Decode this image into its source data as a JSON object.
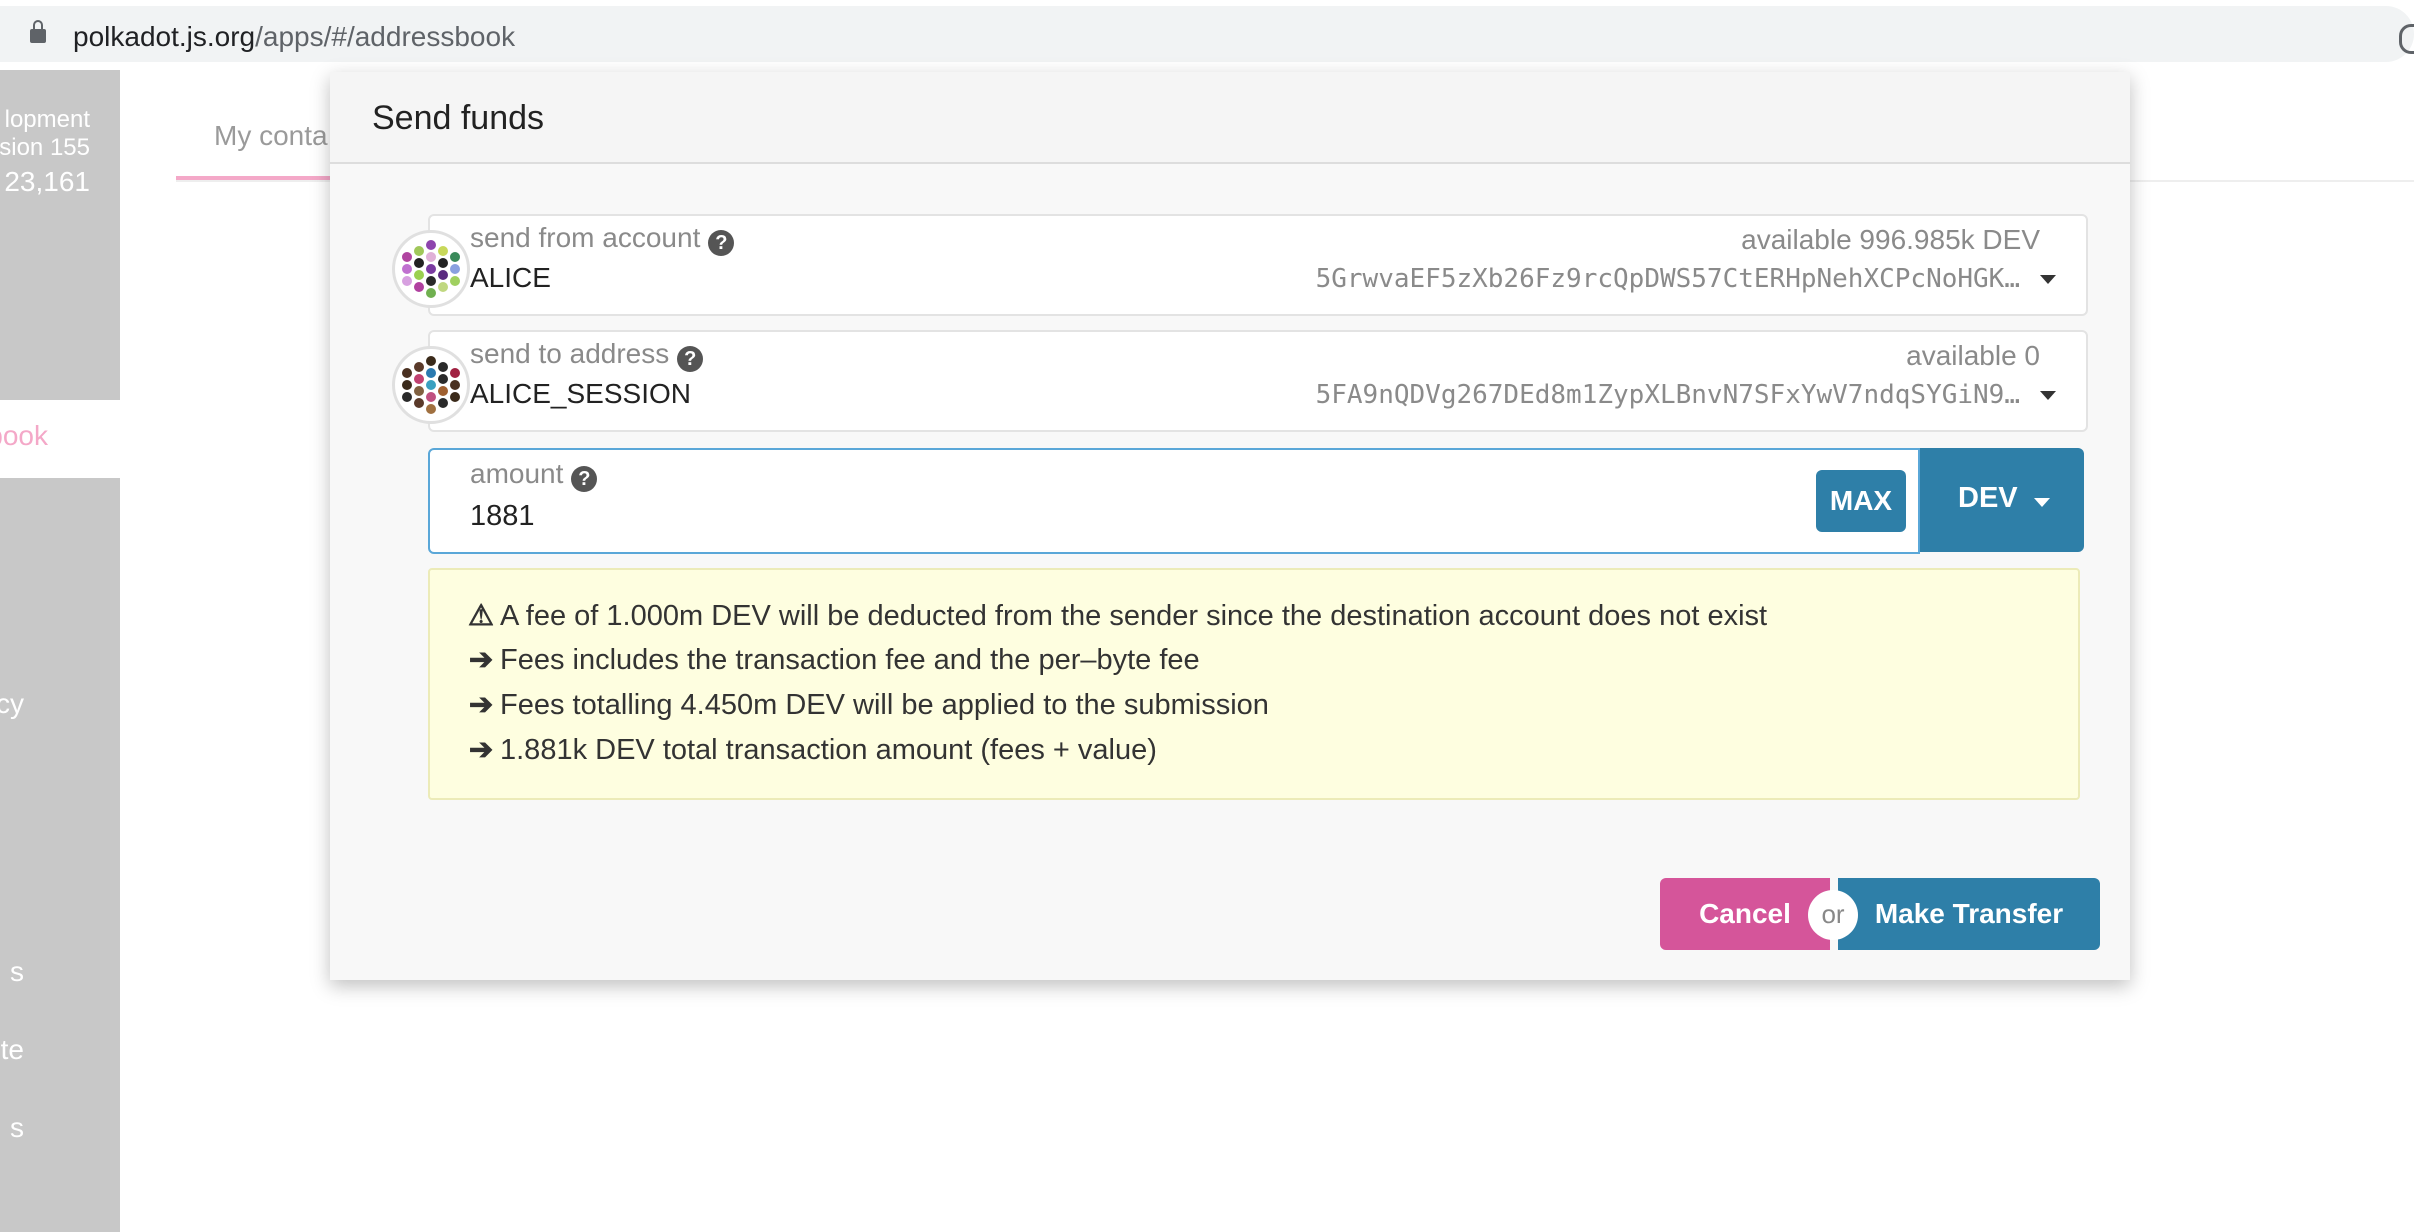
{
  "browser": {
    "url_domain": "polkadot.js.org",
    "url_path": "/apps/#/addressbook"
  },
  "background_app": {
    "chain_label": "lopment",
    "version_label": "sion 155",
    "block_label": "23,161",
    "sidebar_active": "book",
    "sidebar_items": [
      "cy",
      "s",
      "te",
      "s"
    ],
    "tab_contacts": "My conta"
  },
  "modal": {
    "title": "Send funds",
    "from": {
      "label": "send from account",
      "name": "ALICE",
      "available": "available 996.985k DEV",
      "address": "5GrwvaEF5zXb26Fz9rcQpDWS57CtERHpNehXCPcNoHGK…"
    },
    "to": {
      "label": "send to address",
      "name": "ALICE_SESSION",
      "available": "available 0",
      "address": "5FA9nQDVg267DEd8m1ZypXLBnvN7SFxYwV7ndqSYGiN9…"
    },
    "amount": {
      "label": "amount",
      "value": "1881",
      "max_label": "MAX",
      "unit": "DEV"
    },
    "notices": [
      {
        "icon": "warning-icon",
        "glyph": "⚠",
        "text": "A fee of 1.000m DEV will be deducted from the sender since the destination account does not exist"
      },
      {
        "icon": "arrow-right-icon",
        "glyph": "➔",
        "text": "Fees includes the transaction fee and the per–byte fee"
      },
      {
        "icon": "arrow-right-icon",
        "glyph": "➔",
        "text": "Fees totalling 4.450m DEV will be applied to the submission"
      },
      {
        "icon": "arrow-right-icon",
        "glyph": "➔",
        "text": "1.881k DEV total transaction amount (fees + value)"
      }
    ],
    "cancel_label": "Cancel",
    "or_label": "or",
    "transfer_label": "Make Transfer"
  },
  "colors": {
    "primary": "#2e7fa8",
    "cancel": "#d5559a",
    "notice_bg": "#fefee0"
  }
}
